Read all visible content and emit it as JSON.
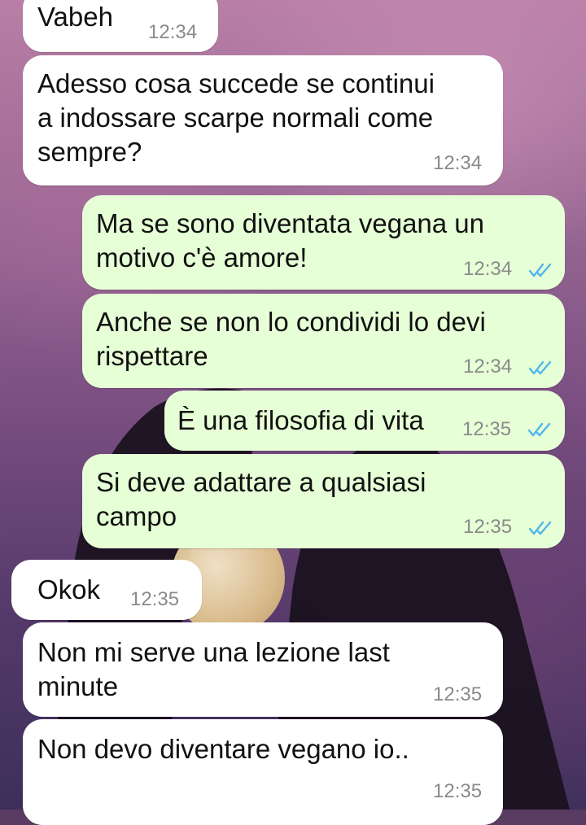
{
  "messages": [
    {
      "direction": "in",
      "text": "Vabeh",
      "time": "12:34"
    },
    {
      "direction": "in",
      "text": "Adesso cosa succede se continui\na indossare scarpe normali come\nsempre?",
      "time": "12:34"
    },
    {
      "direction": "out",
      "text": "Ma se sono diventata vegana un\nmotivo c'è amore!",
      "time": "12:34",
      "status": "read"
    },
    {
      "direction": "out",
      "text": "Anche se non lo condividi lo devi\nrispettare",
      "time": "12:34",
      "status": "read"
    },
    {
      "direction": "out",
      "text": "È una filosofia di vita",
      "time": "12:35",
      "status": "read"
    },
    {
      "direction": "out",
      "text": "Si deve adattare a qualsiasi\ncampo",
      "time": "12:35",
      "status": "read"
    },
    {
      "direction": "in",
      "text": "Okok",
      "time": "12:35"
    },
    {
      "direction": "in",
      "text": "Non mi serve una lezione last\nminute",
      "time": "12:35"
    },
    {
      "direction": "in",
      "text": "Non devo diventare vegano io..",
      "time": "12:35"
    }
  ],
  "icons": {
    "read_receipt": "double-check-icon"
  },
  "colors": {
    "incoming_bubble": "#ffffff",
    "outgoing_bubble": "#e6ffd6",
    "read_tick": "#4fb6ec",
    "timestamp": "#8a8a8a"
  }
}
